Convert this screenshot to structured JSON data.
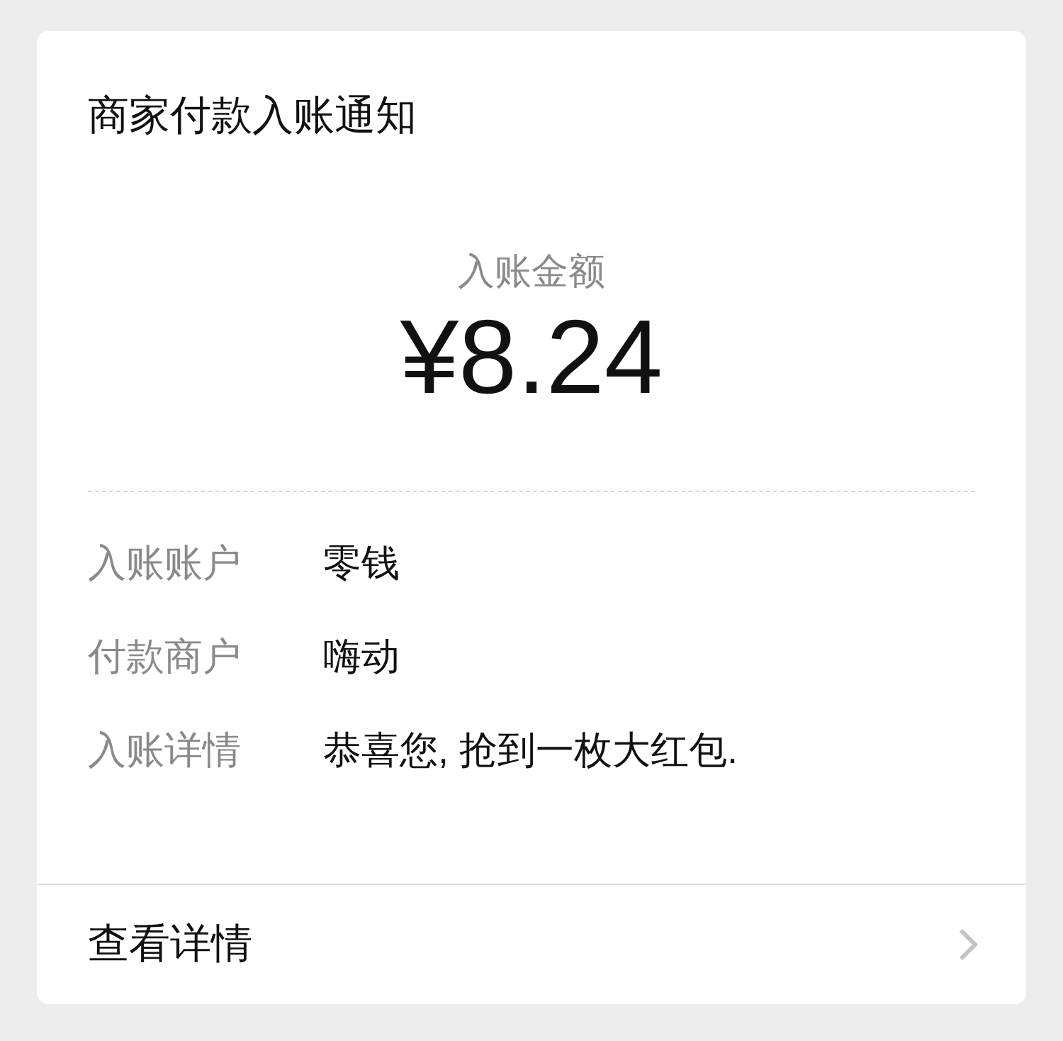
{
  "card": {
    "title": "商家付款入账通知",
    "amount_label": "入账金额",
    "amount": "¥8.24",
    "details": [
      {
        "label": "入账账户",
        "value": "零钱"
      },
      {
        "label": "付款商户",
        "value": "嗨动"
      },
      {
        "label": "入账详情",
        "value": "恭喜您, 抢到一枚大红包."
      }
    ],
    "footer_link": "查看详情"
  }
}
